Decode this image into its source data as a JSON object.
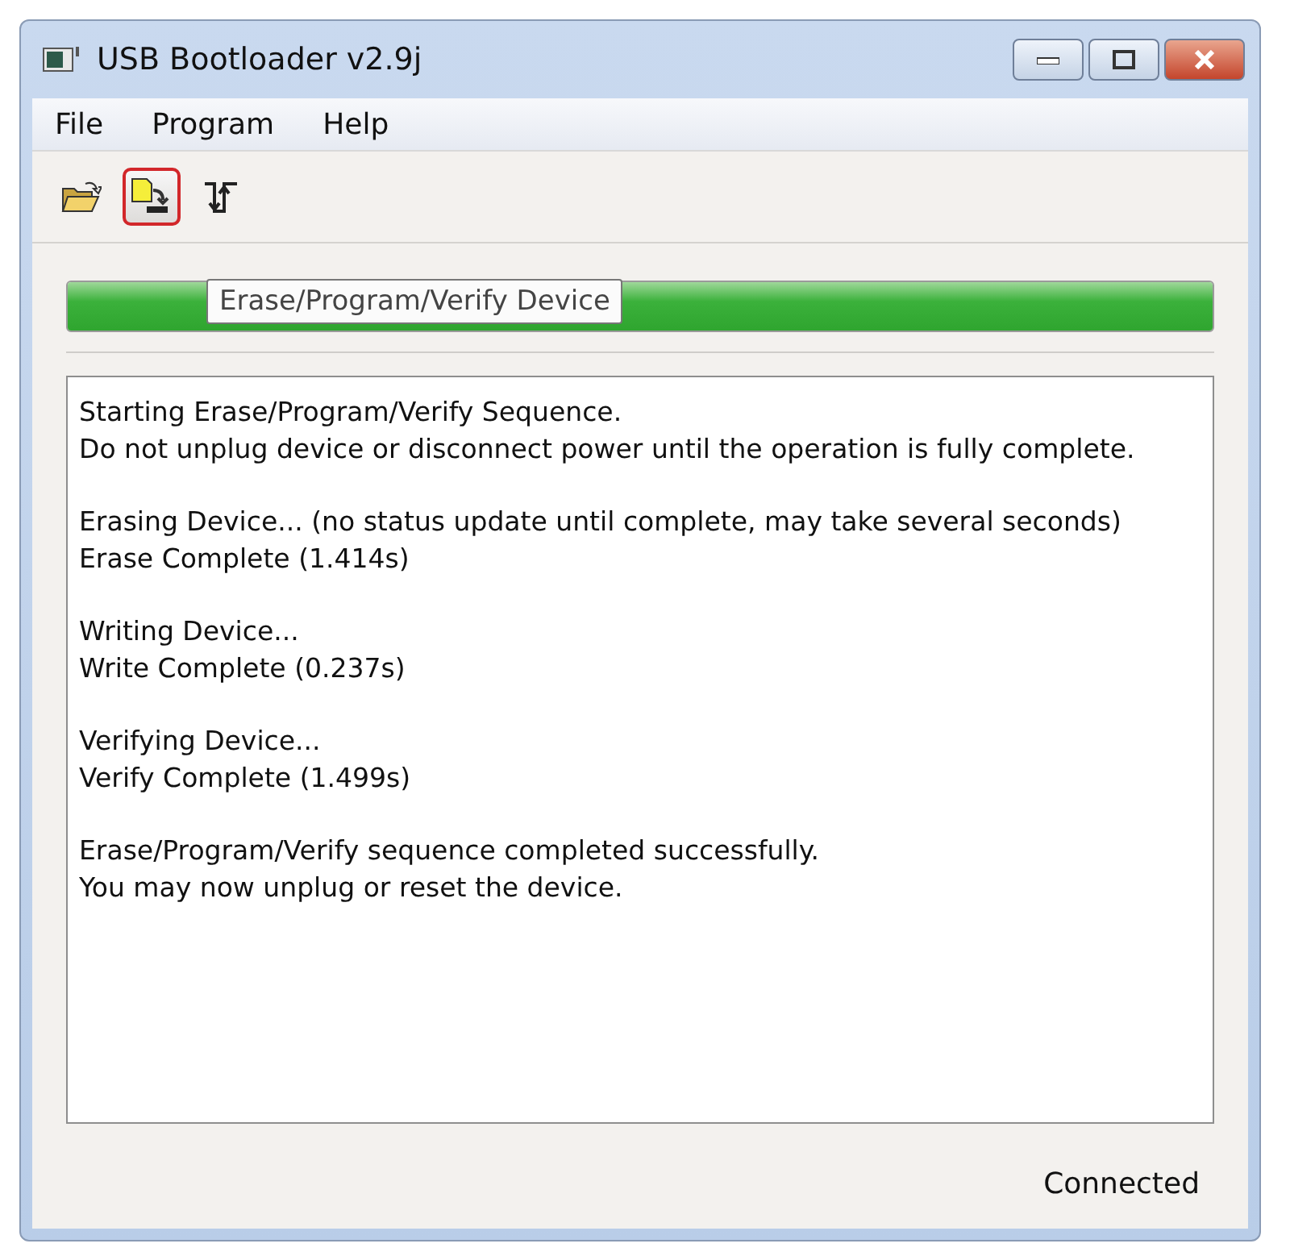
{
  "window": {
    "title": "USB Bootloader v2.9j"
  },
  "menu": [
    "File",
    "Program",
    "Help"
  ],
  "toolbar": [
    {
      "kind": "open",
      "selected": false
    },
    {
      "kind": "program",
      "selected": true
    },
    {
      "kind": "reset",
      "selected": false
    }
  ],
  "tooltip": "Erase/Program/Verify Device",
  "progress": {
    "level": 1
  },
  "log": [
    [
      "Starting Erase/Program/Verify Sequence.",
      "Do not unplug device or disconnect power until the operation is fully complete."
    ],
    [
      "Erasing Device... (no status update until complete, may take several seconds)",
      "Erase Complete (1.414s)"
    ],
    [
      "Writing Device...",
      "Write Complete (0.237s)"
    ],
    [
      "Verifying Device...",
      "Verify Complete (1.499s)"
    ],
    [
      "Erase/Program/Verify sequence completed successfully.",
      "You may now unplug or reset the device."
    ]
  ],
  "status_bar": "Connected"
}
